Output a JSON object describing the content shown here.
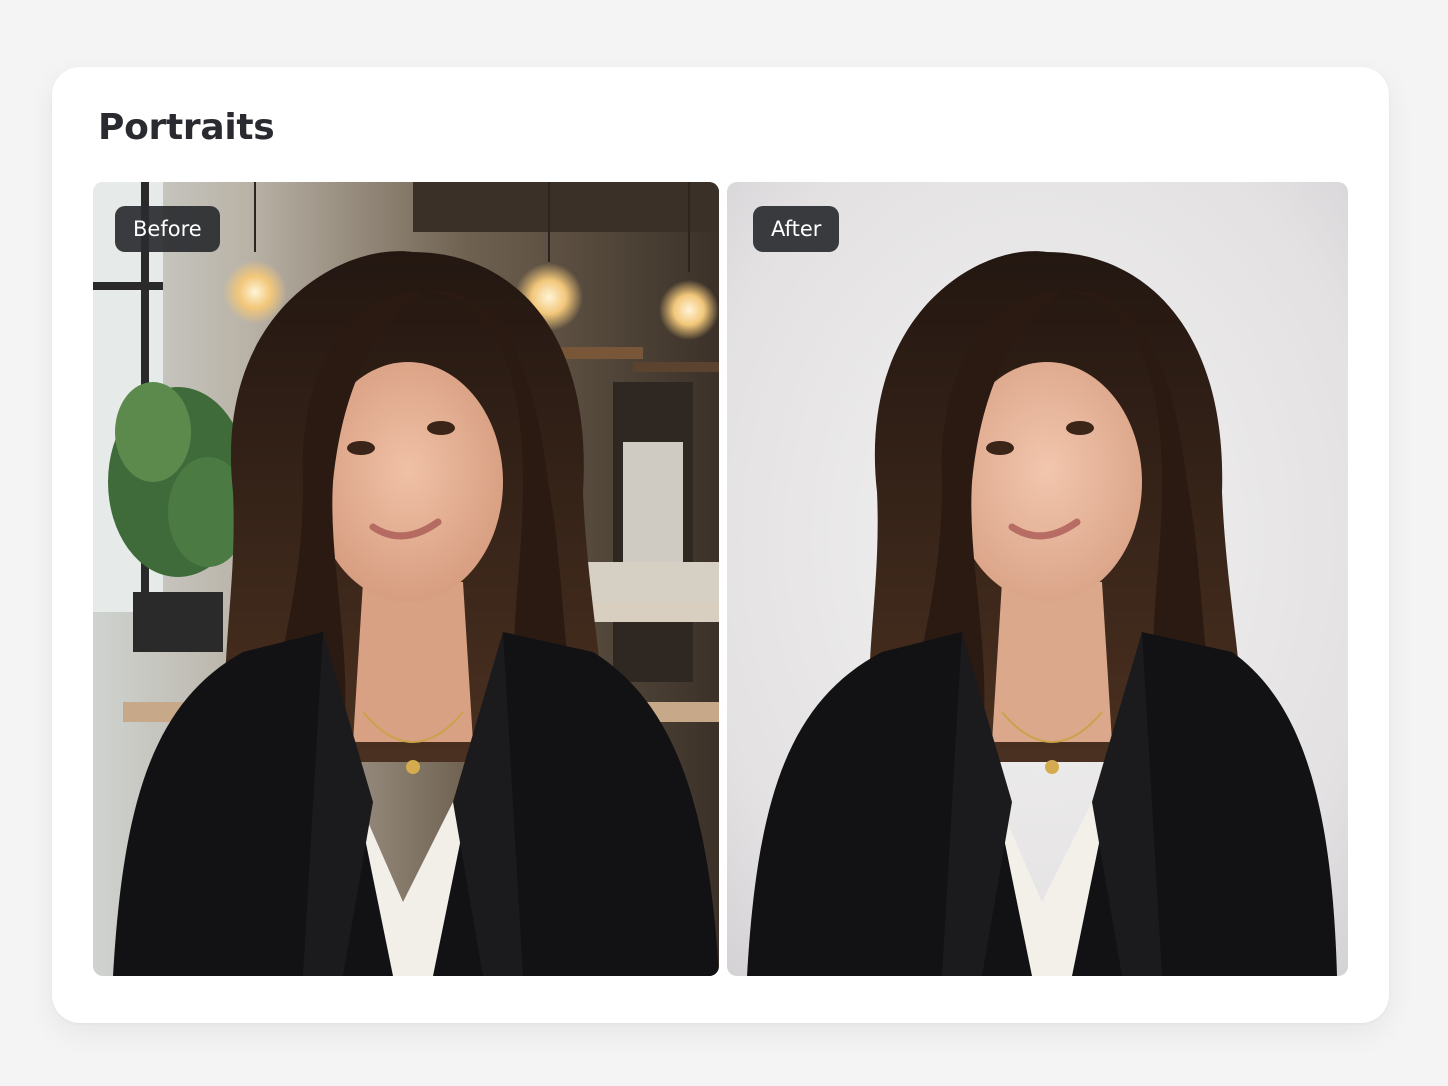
{
  "page": {
    "title": "Portraits"
  },
  "comparison": {
    "before": {
      "label": "Before",
      "scene": "cafe-background"
    },
    "after": {
      "label": "After",
      "scene": "plain-studio-background"
    }
  },
  "colors": {
    "page_bg": "#f4f4f5",
    "card_bg": "#ffffff",
    "title_text": "#2a2b30",
    "badge_bg": "#2a2b2f",
    "badge_text": "#ffffff"
  }
}
